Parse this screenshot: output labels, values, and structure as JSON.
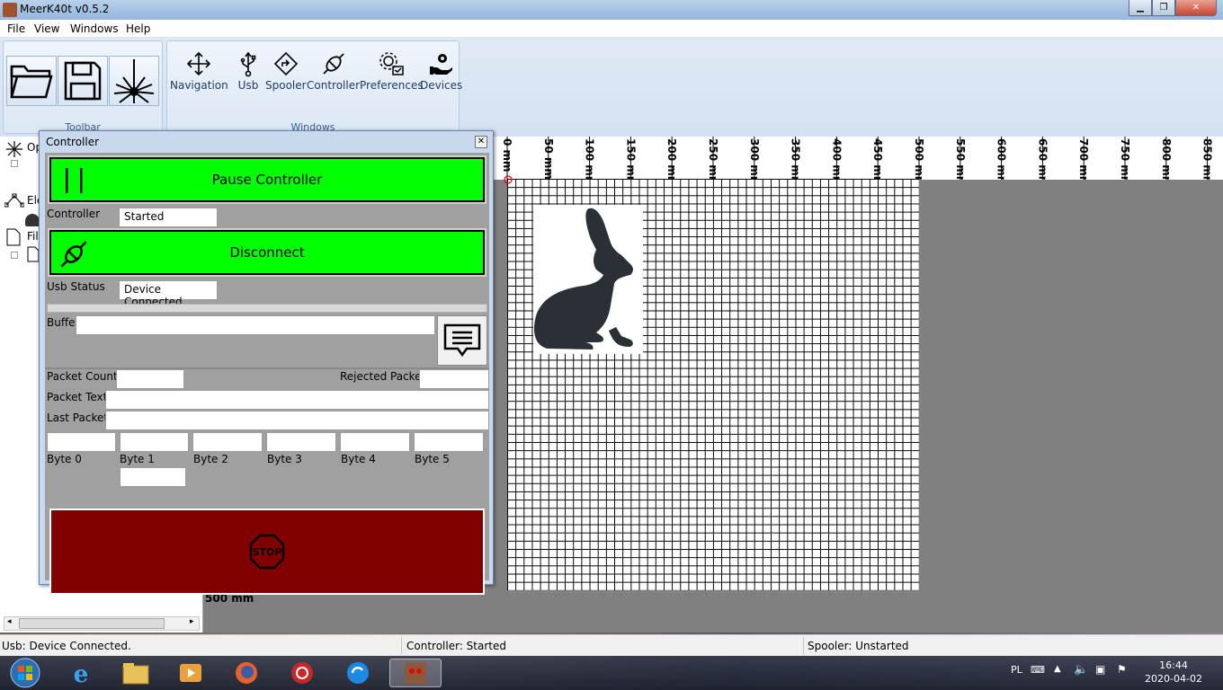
{
  "window": {
    "title": "MeerK40t v0.5.2"
  },
  "menu": [
    "File",
    "View",
    "Windows",
    "Help"
  ],
  "ribbon": {
    "toolbar_group": "Toolbar",
    "windows_group": "Windows",
    "tools": [
      "Navigation",
      "Usb",
      "Spooler",
      "Controller",
      "Preferences",
      "Devices"
    ]
  },
  "tree_fragments": [
    "Op",
    "Ele",
    "Fil"
  ],
  "controller": {
    "title": "Controller",
    "pause_label": "Pause Controller",
    "controller_label": "Controller",
    "controller_value": "Started",
    "disconnect_label": "Disconnect",
    "usb_status_label": "Usb Status",
    "usb_status_value": "Device Connected.",
    "buffer_label": "Buffer",
    "packet_count_label": "Packet Count",
    "rejected_label": "Rejected Packets",
    "packet_text_label": "Packet Text",
    "last_packet_label": "Last Packet",
    "bytes": [
      "Byte 0",
      "Byte 1",
      "Byte 2",
      "Byte 3",
      "Byte 4",
      "Byte 5"
    ],
    "stop_label": "STOP"
  },
  "ruler": [
    "0 mm",
    "50 mm",
    "100 mm",
    "150 mm",
    "200 mm",
    "250 mm",
    "300 mm",
    "350 mm",
    "400 mm",
    "450 mm",
    "500 mm",
    "550 mm",
    "600 mm",
    "650 mm",
    "700 mm",
    "750 mm",
    "800 mm",
    "850 mm"
  ],
  "scale_label": "500 mm",
  "status": {
    "usb": "Usb: Device Connected.",
    "controller": "Controller: Started",
    "spooler": "Spooler: Unstarted"
  },
  "tray": {
    "lang": "PL",
    "time": "16:44",
    "date": "2020-04-02"
  },
  "colors": {
    "accent_green": "#00ff00",
    "stop_red": "#800000"
  }
}
